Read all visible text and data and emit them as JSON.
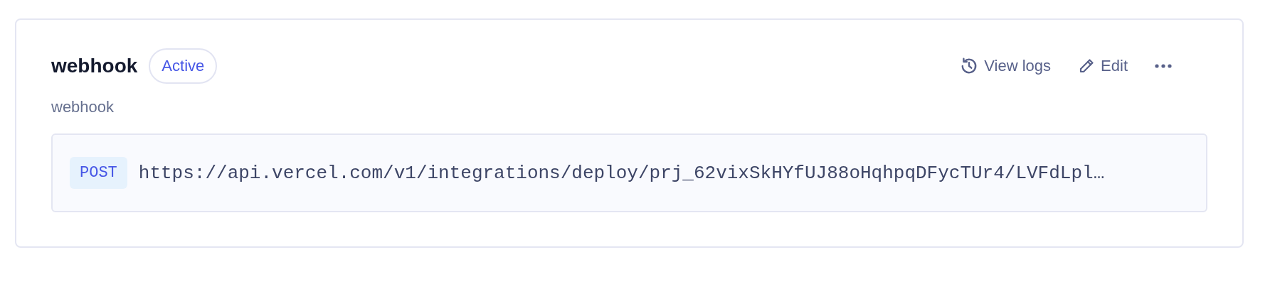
{
  "webhook": {
    "name": "webhook",
    "status": "Active",
    "description": "webhook",
    "actions": [
      {
        "kind": "logs",
        "label": "View logs"
      },
      {
        "kind": "edit",
        "label": "Edit"
      },
      {
        "kind": "more"
      }
    ],
    "method": "POST",
    "url": "https://api.vercel.com/v1/integrations/deploy/prj_62vixSkHYfUJ88oHqhpqDFycTUr4/LVFdLpl…"
  }
}
